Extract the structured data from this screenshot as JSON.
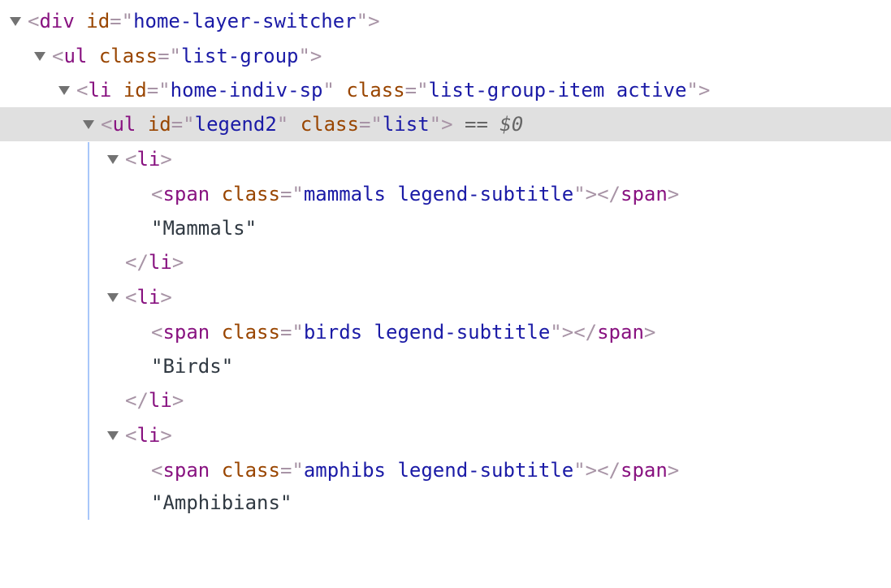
{
  "nodes": {
    "div_open": {
      "tag": "div",
      "id_attr": "id",
      "id_value": "home-layer-switcher"
    },
    "ul_open": {
      "tag": "ul",
      "class_attr": "class",
      "class_value": "list-group"
    },
    "li_open": {
      "tag": "li",
      "id_attr": "id",
      "id_value": "home-indiv-sp",
      "class_attr": "class",
      "class_value": "list-group-item active"
    },
    "ul2_open": {
      "tag": "ul",
      "id_attr": "id",
      "id_value": "legend2",
      "class_attr": "class",
      "class_value": "list",
      "selected_marker": "== $0"
    },
    "items": [
      {
        "tag": "li",
        "span_tag": "span",
        "class_attr": "class",
        "class_value": "mammals legend-subtitle",
        "text": "\"Mammals\"",
        "close": "li"
      },
      {
        "tag": "li",
        "span_tag": "span",
        "class_attr": "class",
        "class_value": "birds legend-subtitle",
        "text": "\"Birds\"",
        "close": "li"
      },
      {
        "tag": "li",
        "span_tag": "span",
        "class_attr": "class",
        "class_value": "amphibs legend-subtitle",
        "text": "\"Amphibians\""
      }
    ]
  },
  "colors": {
    "tag": "#881280",
    "attr_name": "#994500",
    "attr_value": "#1a1aa6",
    "punctuation": "#a894a6",
    "selected_row": "#e0e0e0",
    "guide_line": "#a8c7fa"
  },
  "icons": {
    "expand": "triangle-down-icon"
  }
}
